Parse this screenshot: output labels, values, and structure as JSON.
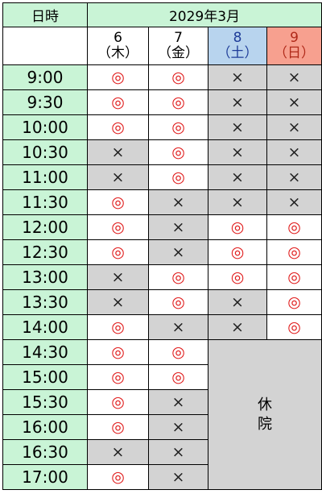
{
  "header": {
    "time_label": "日時",
    "month_label": "2029年3月"
  },
  "days": [
    {
      "date": "6",
      "weekday": "（木）",
      "kind": "weekday"
    },
    {
      "date": "7",
      "weekday": "（金）",
      "kind": "weekday"
    },
    {
      "date": "8",
      "weekday": "（土）",
      "kind": "sat"
    },
    {
      "date": "9",
      "weekday": "（日）",
      "kind": "sun"
    }
  ],
  "symbols": {
    "available": "◎",
    "full": "×"
  },
  "closed_label": "休\n院",
  "colors": {
    "header_green": "#c9f4d6",
    "saturday_blue": "#b8d4ee",
    "sunday_red": "#f7a08f",
    "full_gray": "#d3d3d3",
    "available_red": "#e01a1a"
  },
  "rows": [
    {
      "time": "9:00",
      "slots": [
        "◎",
        "◎",
        "×",
        "×"
      ]
    },
    {
      "time": "9:30",
      "slots": [
        "◎",
        "◎",
        "×",
        "×"
      ]
    },
    {
      "time": "10:00",
      "slots": [
        "◎",
        "◎",
        "×",
        "×"
      ]
    },
    {
      "time": "10:30",
      "slots": [
        "×",
        "◎",
        "×",
        "×"
      ]
    },
    {
      "time": "11:00",
      "slots": [
        "×",
        "◎",
        "×",
        "×"
      ]
    },
    {
      "time": "11:30",
      "slots": [
        "◎",
        "×",
        "×",
        "×"
      ]
    },
    {
      "time": "12:00",
      "slots": [
        "◎",
        "×",
        "◎",
        "◎"
      ]
    },
    {
      "time": "12:30",
      "slots": [
        "◎",
        "×",
        "◎",
        "◎"
      ]
    },
    {
      "time": "13:00",
      "slots": [
        "×",
        "◎",
        "◎",
        "◎"
      ]
    },
    {
      "time": "13:30",
      "slots": [
        "×",
        "◎",
        "×",
        "◎"
      ]
    },
    {
      "time": "14:00",
      "slots": [
        "◎",
        "×",
        "×",
        "◎"
      ]
    },
    {
      "time": "14:30",
      "slots": [
        "◎",
        "◎"
      ]
    },
    {
      "time": "15:00",
      "slots": [
        "◎",
        "◎"
      ]
    },
    {
      "time": "15:30",
      "slots": [
        "◎",
        "×"
      ]
    },
    {
      "time": "16:00",
      "slots": [
        "◎",
        "×"
      ]
    },
    {
      "time": "16:30",
      "slots": [
        "×",
        "×"
      ]
    },
    {
      "time": "17:00",
      "slots": [
        "◎",
        "×"
      ]
    }
  ]
}
